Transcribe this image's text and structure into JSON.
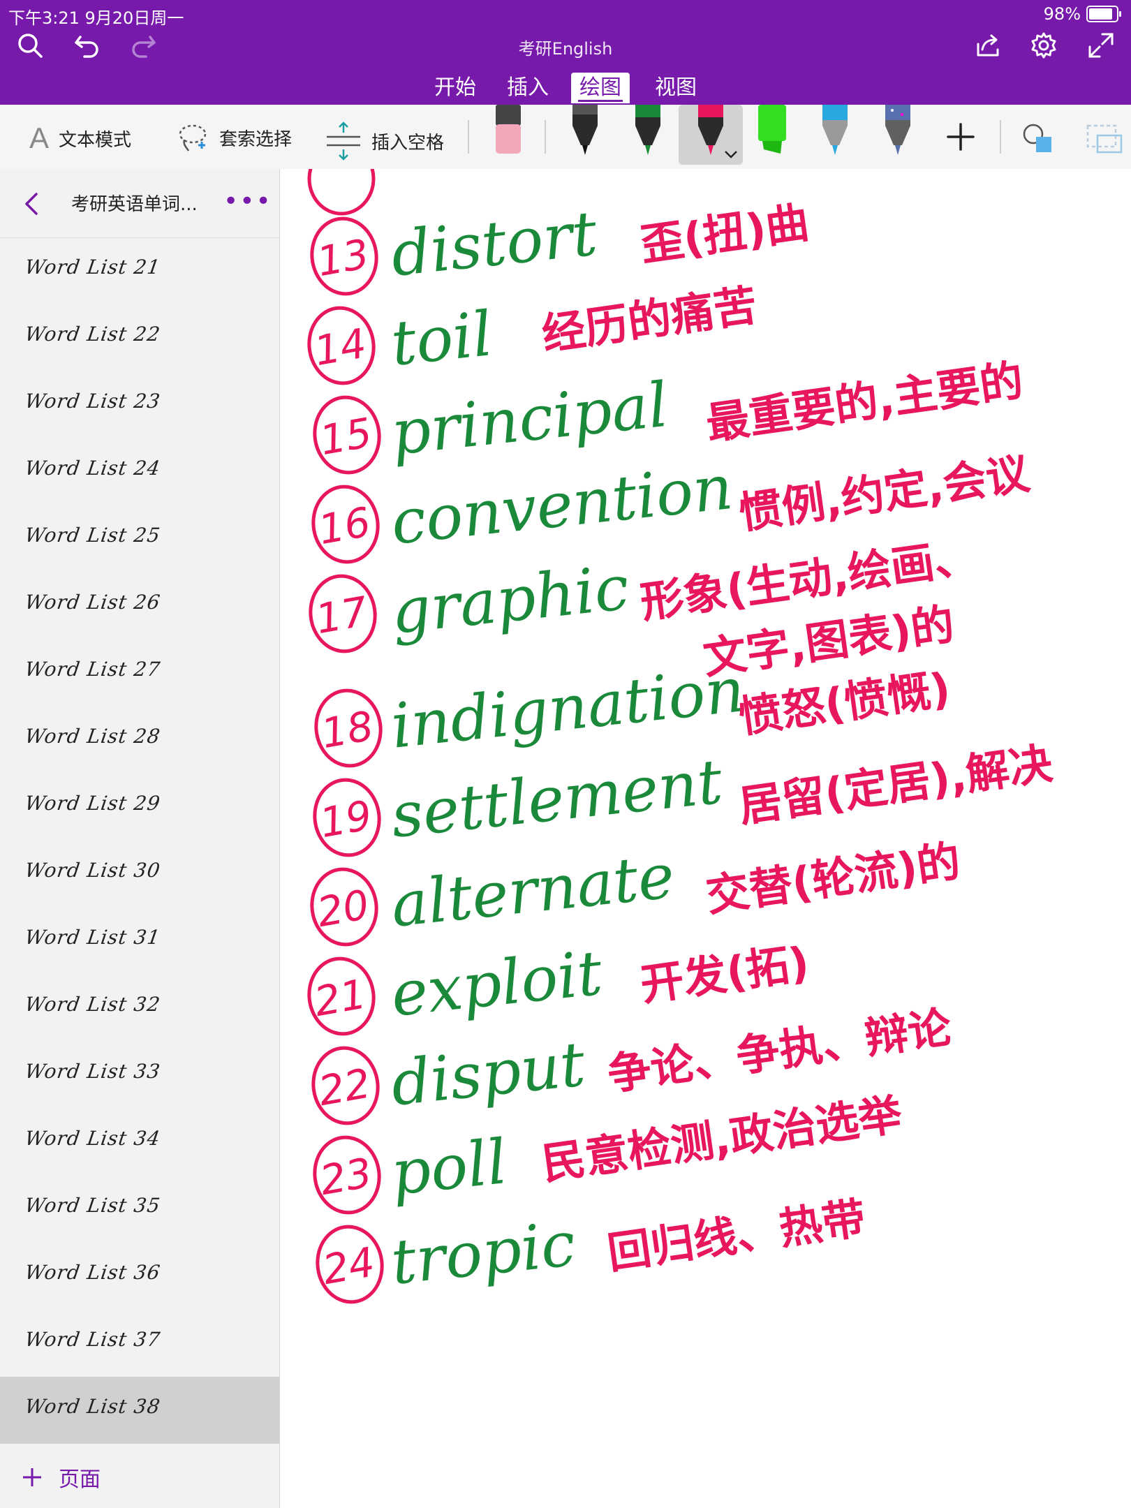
{
  "status_bar": {
    "time_date": "下午3:21   9月20日周一",
    "battery": "98%",
    "battery_level": 0.98
  },
  "app": {
    "title": "考研English"
  },
  "ribbon_tabs": [
    {
      "label": "开始"
    },
    {
      "label": "插入"
    },
    {
      "label": "绘图"
    },
    {
      "label": "视图"
    }
  ],
  "active_tab": "绘图",
  "draw_tools": {
    "text_mode": "文本模式",
    "lasso_select": "套索选择",
    "insert_space": "插入空格"
  },
  "pens": [
    {
      "name": "eraser",
      "color": "#f4a7b9"
    },
    {
      "name": "black-pen",
      "color": "#222222"
    },
    {
      "name": "green-pen",
      "color": "#1a8a3a"
    },
    {
      "name": "pink-pen",
      "color": "#e8175d"
    },
    {
      "name": "green-highlighter",
      "color": "#33dd22"
    },
    {
      "name": "blue-pen",
      "color": "#29a8e0"
    },
    {
      "name": "galaxy-pen",
      "color": "#5a6fb0"
    }
  ],
  "colors": {
    "accent": "#7719aa",
    "ink_english": "#1a8a3a",
    "ink_chinese": "#e8175d",
    "ink_numbers": "#e8175d"
  },
  "sidebar": {
    "notebook_title": "考研英语单词...",
    "pages": [
      "Word List 21",
      "Word List 22",
      "Word List 23",
      "Word List 24",
      "Word List 25",
      "Word List 26",
      "Word List 27",
      "Word List 28",
      "Word List 29",
      "Word List 30",
      "Word List 31",
      "Word List 32",
      "Word List 33",
      "Word List 34",
      "Word List 35",
      "Word List 36",
      "Word List 37",
      "Word List 38"
    ],
    "selected_page": "Word List 38",
    "add_page_label": "页面"
  },
  "notes": [
    {
      "num": "13",
      "word": "distort",
      "meaning": "歪(扭)曲"
    },
    {
      "num": "14",
      "word": "toil",
      "meaning": "经历的痛苦"
    },
    {
      "num": "15",
      "word": "principal",
      "meaning": "最重要的,主要的"
    },
    {
      "num": "16",
      "word": "convention",
      "meaning": "惯例,约定,会议"
    },
    {
      "num": "17",
      "word": "graphic",
      "meaning": "形象(生动,绘画、",
      "meaning2": "文字,图表)的"
    },
    {
      "num": "18",
      "word": "indignation",
      "meaning": "愤怒(愤慨)"
    },
    {
      "num": "19",
      "word": "settlement",
      "meaning": "居留(定居),解决"
    },
    {
      "num": "20",
      "word": "alternate",
      "meaning": "交替(轮流)的"
    },
    {
      "num": "21",
      "word": "exploit",
      "meaning": "开发(拓)"
    },
    {
      "num": "22",
      "word": "disput",
      "meaning": "争论、争执、辩论"
    },
    {
      "num": "23",
      "word": "poll",
      "meaning": "民意检测,政治选举"
    },
    {
      "num": "24",
      "word": "tropic",
      "meaning": "回归线、热带"
    }
  ]
}
